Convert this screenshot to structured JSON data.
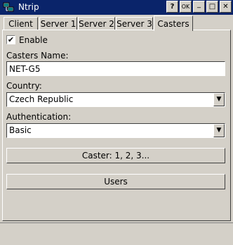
{
  "window": {
    "title": "Ntrip",
    "ok_label": "OK",
    "minimize_glyph": "_",
    "maximize_glyph": "□",
    "close_glyph": "✕"
  },
  "tabs": [
    {
      "label": "Client",
      "active": false
    },
    {
      "label": "Server 1",
      "active": false
    },
    {
      "label": "Server 2",
      "active": false
    },
    {
      "label": "Server 3",
      "active": false
    },
    {
      "label": "Casters",
      "active": true
    }
  ],
  "casters": {
    "enable_label": "Enable",
    "enable_checked": true,
    "name_label": "Casters Name:",
    "name_value": "NET-G5",
    "country_label": "Country:",
    "country_value": "Czech Republic",
    "auth_label": "Authentication:",
    "auth_value": "Basic",
    "caster_button": "Caster: 1, 2, 3...",
    "users_button": "Users"
  },
  "icons": {
    "app": "network-computers-icon",
    "dropdown": "chevron-down-icon",
    "check": "checkmark-icon"
  }
}
